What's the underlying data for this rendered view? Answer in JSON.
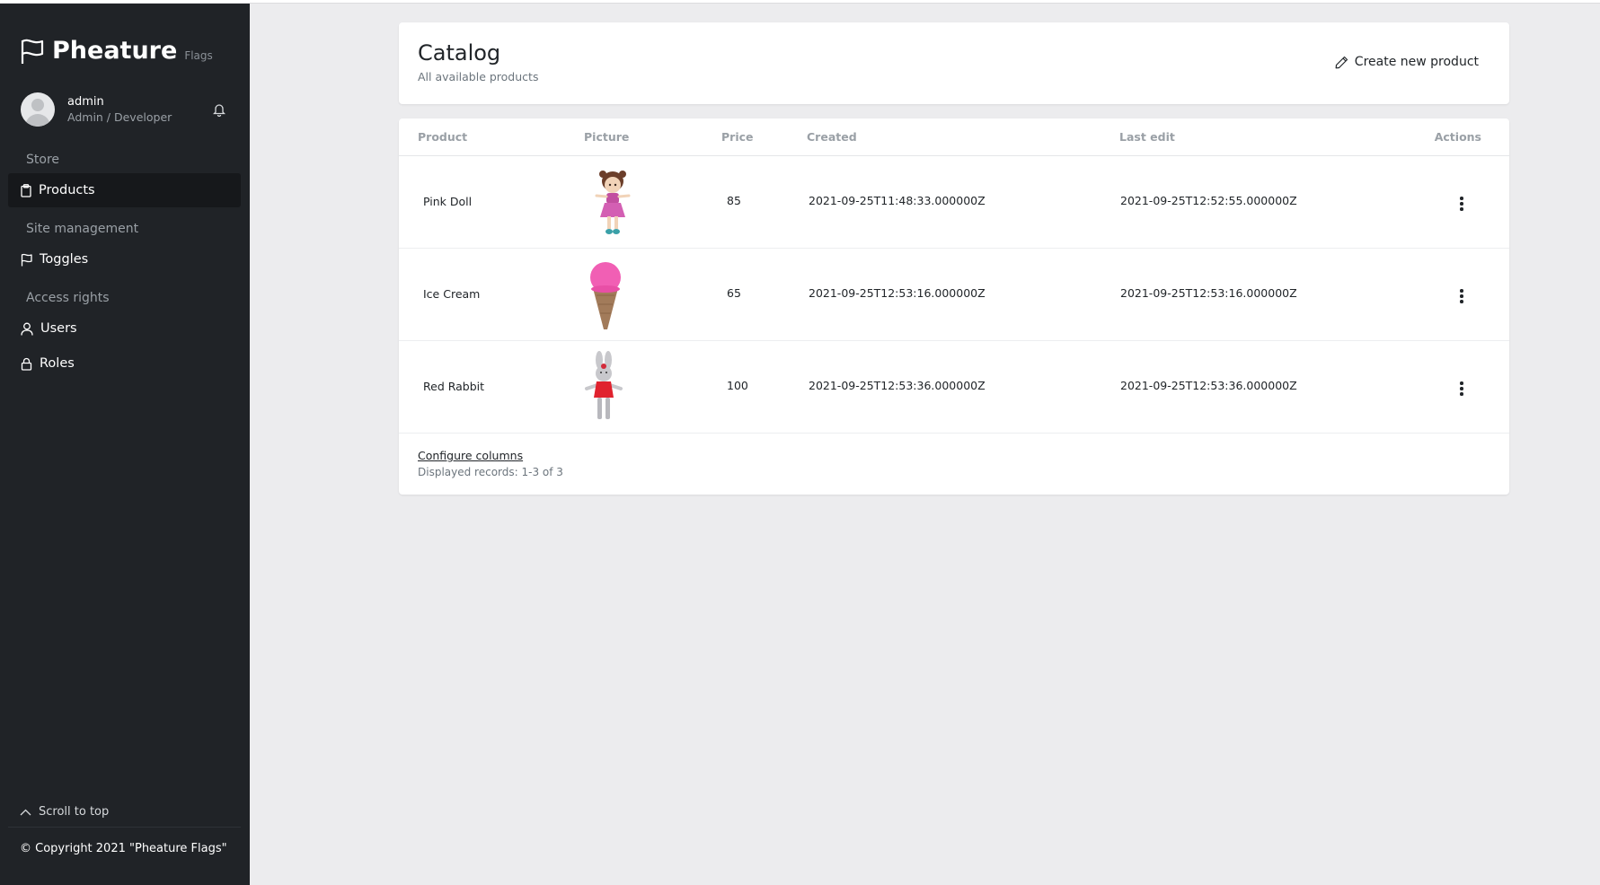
{
  "brand": {
    "name": "Pheature",
    "sub": "Flags"
  },
  "user": {
    "name": "admin",
    "role": "Admin / Developer"
  },
  "nav": {
    "sections": [
      {
        "label": "Store",
        "items": [
          {
            "label": "Products",
            "icon": "clipboard-icon",
            "active": true
          }
        ]
      },
      {
        "label": "Site management",
        "items": [
          {
            "label": "Toggles",
            "icon": "flag-icon"
          }
        ]
      },
      {
        "label": "Access rights",
        "items": [
          {
            "label": "Users",
            "icon": "user-icon"
          },
          {
            "label": "Roles",
            "icon": "lock-icon"
          }
        ]
      }
    ]
  },
  "footer": {
    "scroll_top": "Scroll to top",
    "copyright": "© Copyright 2021 \"Pheature Flags\""
  },
  "page": {
    "title": "Catalog",
    "subtitle": "All available products",
    "create_button": "Create new product"
  },
  "table": {
    "columns": [
      "Product",
      "Picture",
      "Price",
      "Created",
      "Last edit",
      "Actions"
    ],
    "rows": [
      {
        "product": "Pink Doll",
        "picture": "pink-doll-image",
        "price": "85",
        "created": "2021-09-25T11:48:33.000000Z",
        "last_edit": "2021-09-25T12:52:55.000000Z"
      },
      {
        "product": "Ice Cream",
        "picture": "ice-cream-image",
        "price": "65",
        "created": "2021-09-25T12:53:16.000000Z",
        "last_edit": "2021-09-25T12:53:16.000000Z"
      },
      {
        "product": "Red Rabbit",
        "picture": "red-rabbit-image",
        "price": "100",
        "created": "2021-09-25T12:53:36.000000Z",
        "last_edit": "2021-09-25T12:53:36.000000Z"
      }
    ],
    "configure_columns": "Configure columns",
    "records": "Displayed records: 1-3 of 3"
  },
  "colors": {
    "sidebar": "#202327",
    "active_item": "#16181b",
    "background": "#ececee"
  }
}
